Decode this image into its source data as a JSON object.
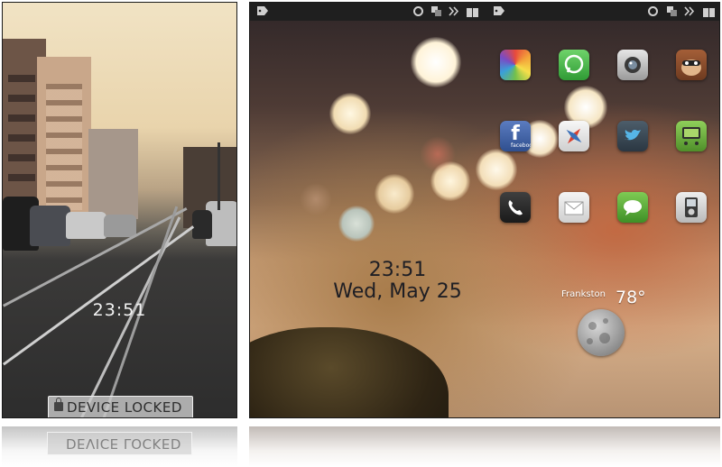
{
  "lock_screen": {
    "time": "23:51",
    "badge_label": "DEVICE LOCKED",
    "lock_icon": "padlock-icon"
  },
  "home_screen": {
    "status_bar": {
      "left_icon": "tag-icon",
      "right_icons": [
        "circle-icon",
        "windows-icon",
        "arrows-icon",
        "battery-icon"
      ]
    },
    "clock": {
      "time": "23:51",
      "date": "Wed, May 25"
    },
    "weather": {
      "city": "Frankston",
      "temperature": "78°",
      "icon": "moon-icon"
    },
    "apps": [
      {
        "icon": "photos-app-icon",
        "color": "#e8a23a"
      },
      {
        "icon": "whatsapp-app-icon",
        "color": "#45b24d"
      },
      {
        "icon": "camera-app-icon",
        "color": "#b9b9b9"
      },
      {
        "icon": "monkey-app-icon",
        "color": "#8c4b2b"
      },
      {
        "icon": "facebook-app-icon",
        "color": "#3d5c9e"
      },
      {
        "icon": "compass-app-icon",
        "color": "#e7e7e7"
      },
      {
        "icon": "twitter-app-icon",
        "color": "#3b4a57"
      },
      {
        "icon": "game-app-icon",
        "color": "#6cb43a"
      },
      {
        "icon": "phone-app-icon",
        "color": "#2b2b2b"
      },
      {
        "icon": "mail-app-icon",
        "color": "#e3e3e3"
      },
      {
        "icon": "messages-app-icon",
        "color": "#66b23e"
      },
      {
        "icon": "ipod-app-icon",
        "color": "#d5d5d5"
      }
    ],
    "app_labels": {
      "facebook": "facebook"
    }
  }
}
